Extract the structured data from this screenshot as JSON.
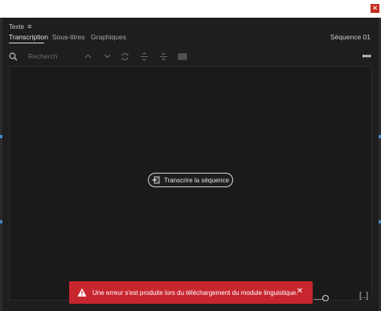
{
  "window": {
    "close_label": "✕"
  },
  "panel": {
    "title": "Texte",
    "menu_icon": "menu-icon"
  },
  "tabs": [
    {
      "label": "Transcription",
      "active": true
    },
    {
      "label": "Sous-titres",
      "active": false
    },
    {
      "label": "Graphiques",
      "active": false
    }
  ],
  "sequence": {
    "label": "Séquence 01"
  },
  "toolbar": {
    "search_placeholder": "Recherch",
    "icons": [
      "search-icon",
      "chevron-up-icon",
      "chevron-down-icon",
      "sync-icon",
      "split-icon",
      "merge-icon",
      "caption-icon"
    ],
    "more_label": "•••"
  },
  "main": {
    "transcribe_label": "Transcrire la séquence"
  },
  "toast": {
    "message": "Une erreur s'est produite lors du téléchargement du module linguistique.",
    "close_label": "✕",
    "color": "#c8262f"
  },
  "footer": {
    "fullscreen_label": "[..]"
  }
}
